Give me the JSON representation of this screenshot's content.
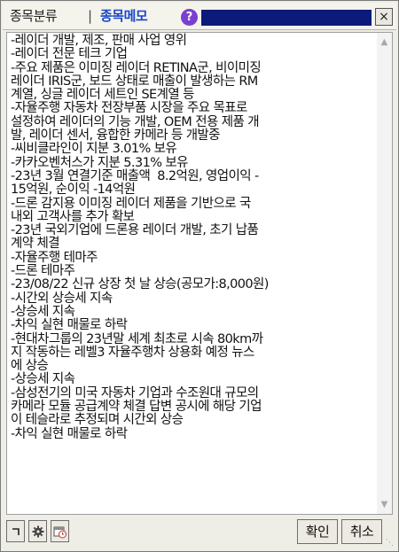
{
  "title_bar": {
    "tab_category": "종목분류",
    "separator": "|",
    "tab_memo": "종목메모",
    "help_glyph": "?",
    "close_glyph": "×"
  },
  "memo_lines": [
    "-레이더 개발, 제조, 판매 사업 영위",
    "-레이더 전문 테크 기업",
    "-주요 제품은 이미징 레이더 RETINA군, 비이미징",
    "레이더 IRIS군, 보드 상태로 매출이 발생하는 RM",
    "계열, 싱글 레이더 세트인 SE계열 등",
    "-자율주행 자동차 전장부품 시장을 주요 목표로",
    "설정하여 레이더의 기능 개발, OEM 전용 제품 개",
    "발, 레이더 센서, 융합한 카메라 등 개발중",
    "-씨비클라인이 지분 3.01% 보유",
    "-카카오벤처스가 지분 5.31% 보유",
    "-23년 3월 연결기준 매출액  8.2억원, 영업이익 -",
    "15억원, 순이익 -14억원",
    "-드론 감지용 이미징 레이더 제품을 기반으로 국",
    "내외 고객사를 추가 확보",
    "-23년 국외기업에 드론용 레이더 개발, 초기 납품",
    "계약 체결",
    "-자율주행 테마주",
    "-드론 테마주",
    "-23/08/22 신규 상장 첫 날 상승(공모가:8,000원)",
    "-시간외 상승세 지속",
    "-상승세 지속",
    "-차익 실현 매물로 하락",
    "-현대차그룹의 23년말 세계 최초로 시속 80km까",
    "지 작동하는 레벨3 자율주행차 상용화 예정 뉴스",
    "에 상승",
    "-상승세 지속",
    "-삼성전기의 미국 자동차 기업과 수조원대 규모의",
    "카메라 모듈 공급계약 체결 답변 공시에 해당 기업",
    "이 테슬라로 추정되며 시간외 상승",
    "-차익 실현 매물로 하락"
  ],
  "footer": {
    "ok_label": "확인",
    "cancel_label": "취소",
    "tool_icons": [
      "corner-bracket-icon",
      "gear-icon",
      "clock-calendar-icon"
    ]
  },
  "colors": {
    "memo_tab": "#1846c8",
    "help_badge": "#7a3fcf",
    "title_fill_bar": "#0c1a7a"
  }
}
